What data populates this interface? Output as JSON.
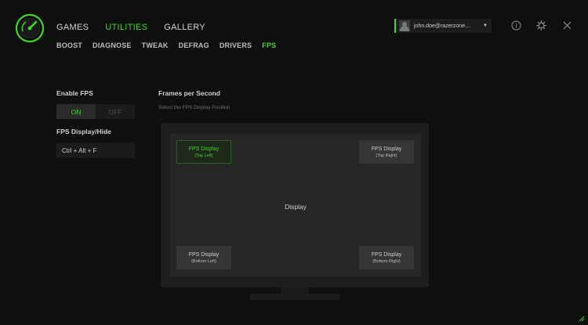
{
  "nav": {
    "main": [
      {
        "label": "GAMES",
        "active": false
      },
      {
        "label": "UTILITIES",
        "active": true
      },
      {
        "label": "GALLERY",
        "active": false
      }
    ],
    "sub": [
      {
        "label": "BOOST",
        "active": false
      },
      {
        "label": "DIAGNOSE",
        "active": false
      },
      {
        "label": "TWEAK",
        "active": false
      },
      {
        "label": "DEFRAG",
        "active": false
      },
      {
        "label": "DRIVERS",
        "active": false
      },
      {
        "label": "FPS",
        "active": true
      }
    ]
  },
  "account": {
    "email": "john.doe@razerzone....",
    "avatar_icon": "user-avatar"
  },
  "top_icons": [
    "info-icon",
    "gear-icon",
    "close-icon"
  ],
  "fps": {
    "enable_label": "Enable FPS",
    "toggle_on": "ON",
    "toggle_off": "OFF",
    "toggle_state": "on",
    "display_hide_label": "FPS Display/Hide",
    "hotkey": "Ctrl + Alt + F",
    "section_title": "Frames per Second",
    "section_desc": "Select the FPS Display Position",
    "display_label": "Display",
    "positions": {
      "top_left": {
        "title": "FPS Display",
        "sub": "(Top Left)",
        "selected": true
      },
      "top_right": {
        "title": "FPS Display",
        "sub": "(Top Right)",
        "selected": false
      },
      "bottom_left": {
        "title": "FPS Display",
        "sub": "(Bottom Left)",
        "selected": false
      },
      "bottom_right": {
        "title": "FPS Display",
        "sub": "(Bottom Right)",
        "selected": false
      }
    }
  },
  "colors": {
    "accent": "#44d62c",
    "background": "#0f0f0f",
    "panel": "#1b1b1b"
  }
}
